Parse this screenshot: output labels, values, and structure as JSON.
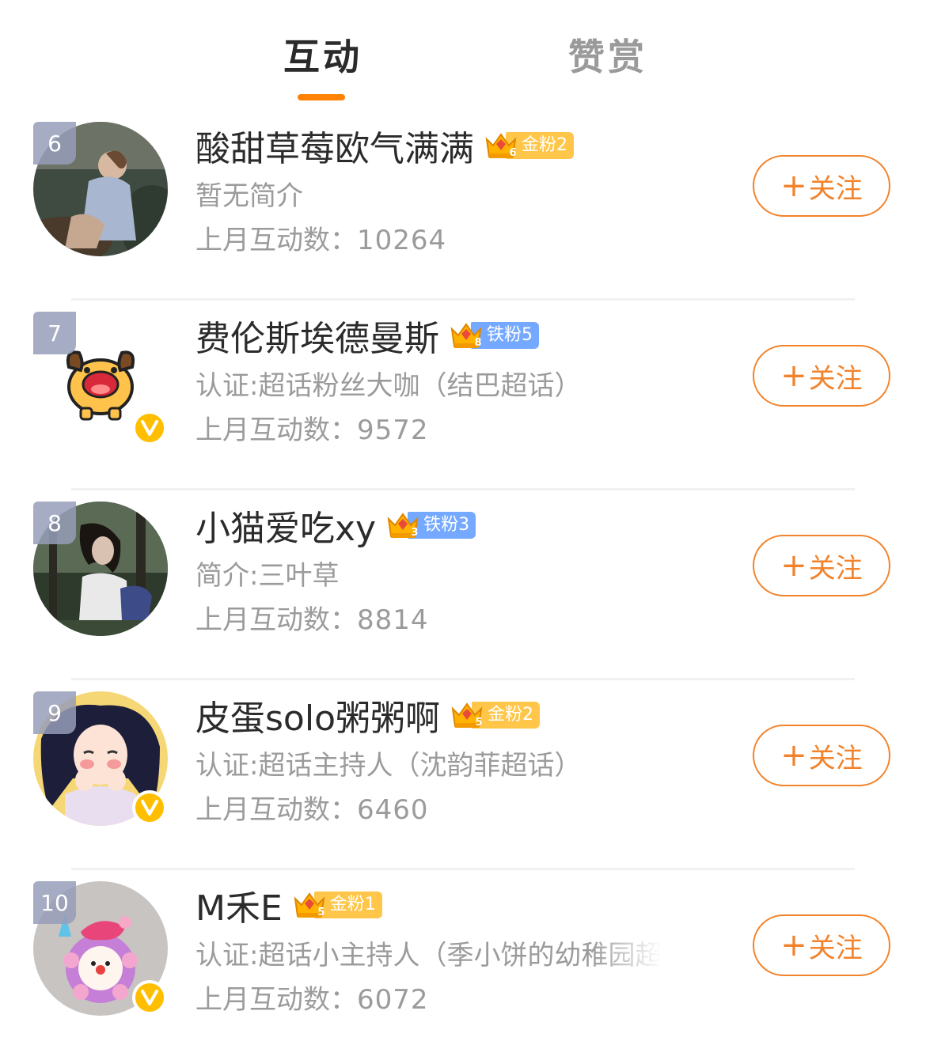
{
  "tabs": [
    {
      "label": "互动",
      "active": true
    },
    {
      "label": "赞赏",
      "active": false
    }
  ],
  "follow_label": "关注",
  "follow_plus": "+",
  "count_label": "上月互动数：",
  "colors": {
    "accent": "#ff8200",
    "follow": "#f2832b",
    "gold_badge": "#ffc64a",
    "iron_badge": "#74a9ff",
    "verified": "#ffbf00"
  },
  "fans": [
    {
      "rank": "6",
      "name": "酸甜草莓欧气满满",
      "badge_type": "gold",
      "badge_level": "6",
      "badge_text": "金粉2",
      "desc": "暂无简介",
      "count": "10264",
      "verified": false,
      "avatar": "photo-woman-sitting-icon"
    },
    {
      "rank": "7",
      "name": "费伦斯埃德曼斯",
      "badge_type": "iron",
      "badge_level": "8",
      "badge_text": "铁粉5",
      "desc": "认证:超话粉丝大咖（结巴超话）",
      "count": "9572",
      "verified": true,
      "avatar": "cartoon-dog-icon"
    },
    {
      "rank": "8",
      "name": "小猫爱吃xy",
      "badge_type": "iron",
      "badge_level": "3",
      "badge_text": "铁粉3",
      "desc": "简介:三叶草",
      "count": "8814",
      "verified": false,
      "avatar": "photo-woman-forest-icon"
    },
    {
      "rank": "9",
      "name": "皮蛋solo粥粥啊",
      "badge_type": "gold",
      "badge_level": "5",
      "badge_text": "金粉2",
      "desc": "认证:超话主持人（沈韵菲超话）",
      "count": "6460",
      "verified": true,
      "avatar": "illustrated-girl-icon"
    },
    {
      "rank": "10",
      "name": "M禾E",
      "badge_type": "gold",
      "badge_level": "5",
      "badge_text": "金粉1",
      "desc": "认证:超话小主持人（季小饼的幼稚园超",
      "count": "6072",
      "verified": true,
      "avatar": "clown-clay-figure-icon"
    }
  ]
}
